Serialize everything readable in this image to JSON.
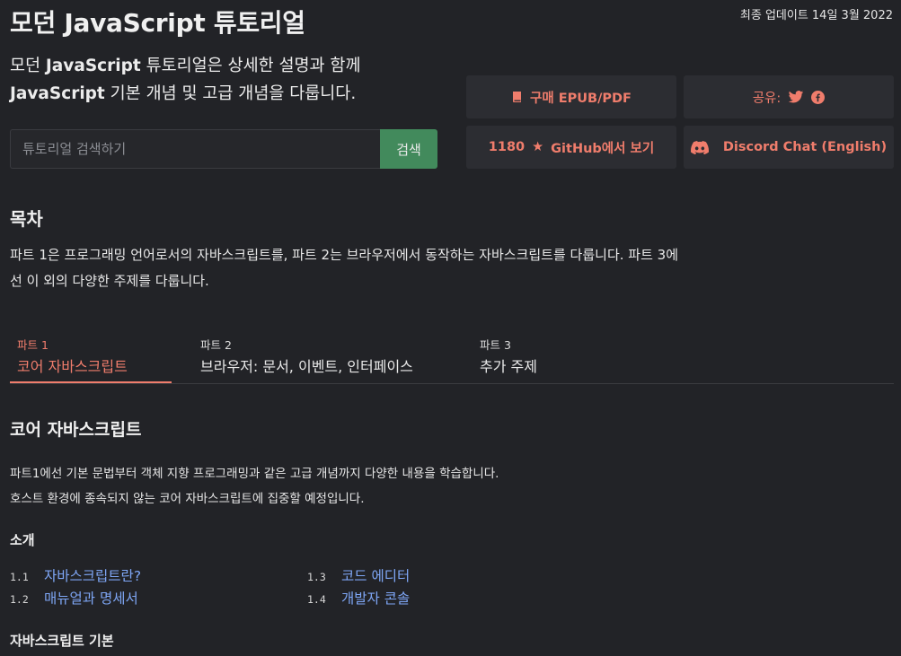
{
  "header": {
    "title": "모던 JavaScript 튜토리얼",
    "updated": "최종 업데이트 14일 3월 2022"
  },
  "intro": {
    "prefix": "모던 ",
    "strong1": "JavaScript",
    "middle": " 튜토리얼은 상세한 설명과 함께",
    "strong2": "JavaScript",
    "suffix": " 기본 개념 및 고급 개념을 다룹니다."
  },
  "search": {
    "placeholder": "튜토리얼 검색하기",
    "value": "",
    "button_label": "검색"
  },
  "actions": {
    "buy_label": "구매 EPUB/PDF",
    "share_label": "공유:",
    "github_count": "1180",
    "github_label": "GitHub에서 보기",
    "discord_label": "Discord Chat (English)"
  },
  "icons": {
    "book": "book-icon",
    "twitter": "twitter-icon",
    "facebook": "facebook-icon",
    "star": "★",
    "discord": "discord-icon"
  },
  "colors": {
    "background": "#222327",
    "accent": "#f07d6c",
    "link": "#7ea6f5",
    "search_button": "#428a5c",
    "card": "#2c2d32"
  },
  "toc": {
    "heading": "목차",
    "description": "파트 1은 프로그래밍 언어로서의 자바스크립트를, 파트 2는 브라우저에서 동작하는 자바스크립트를 다룹니다. 파트 3에선 이 외의 다양한 주제를 다룹니다."
  },
  "tabs": [
    {
      "num": "파트 1",
      "label": "코어 자바스크립트"
    },
    {
      "num": "파트 2",
      "label": "브라우저: 문서, 이벤트, 인터페이스"
    },
    {
      "num": "파트 3",
      "label": "추가 주제"
    }
  ],
  "section": {
    "title": "코어 자바스크립트",
    "desc_line1": "파트1에선 기본 문법부터 객체 지향 프로그래밍과 같은 고급 개념까지 다양한 내용을 학습합니다.",
    "desc_line2": "호스트 환경에 종속되지 않는 코어 자바스크립트에 집중할 예정입니다."
  },
  "chapters": [
    {
      "title": "소개",
      "items": [
        {
          "num": "1.1",
          "label": "자바스크립트란?"
        },
        {
          "num": "1.2",
          "label": "매뉴얼과 명세서"
        },
        {
          "num": "1.3",
          "label": "코드 에디터"
        },
        {
          "num": "1.4",
          "label": "개발자 콘솔"
        }
      ]
    },
    {
      "title": "자바스크립트 기본"
    }
  ]
}
